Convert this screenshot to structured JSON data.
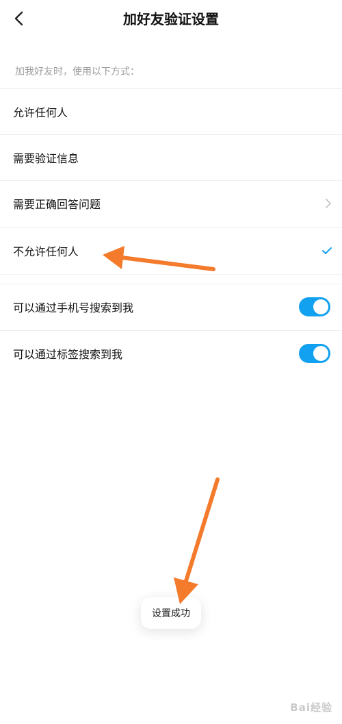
{
  "header": {
    "title": "加好友验证设置"
  },
  "section": {
    "label": "加我好友时，使用以下方式："
  },
  "options": [
    {
      "label": "允许任何人"
    },
    {
      "label": "需要验证信息"
    },
    {
      "label": "需要正确回答问题"
    },
    {
      "label": "不允许任何人",
      "selected": true
    }
  ],
  "toggles": [
    {
      "label": "可以通过手机号搜索到我",
      "on": true
    },
    {
      "label": "可以通过标签搜索到我",
      "on": true
    }
  ],
  "toast": {
    "text": "设置成功"
  },
  "colors": {
    "accent": "#12a1f0",
    "arrow": "#f47a2c"
  },
  "watermark": {
    "text": "Bai经验"
  }
}
